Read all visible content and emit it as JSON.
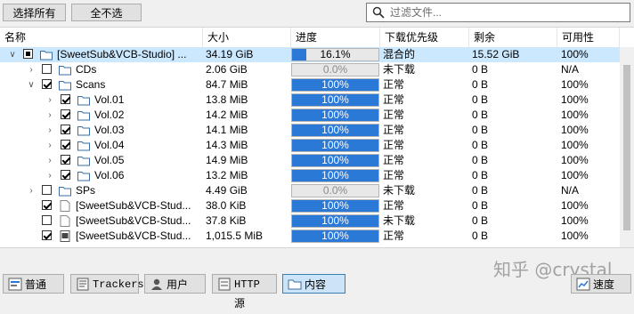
{
  "toolbar": {
    "select_all_label": "选择所有",
    "select_none_label": "全不选",
    "filter_placeholder": "过滤文件..."
  },
  "columns": [
    "名称",
    "大小",
    "进度",
    "下载优先级",
    "剩余",
    "可用性"
  ],
  "rows": [
    {
      "name": "[SweetSub&VCB-Studio] ...",
      "size": "34.19 GiB",
      "progress_text": "16.1%",
      "progress": 0.161,
      "priority": "混合的",
      "remaining": "15.52 GiB",
      "availability": "100%",
      "check": "partial",
      "type": "folder",
      "expander": "open",
      "level": 0
    },
    {
      "name": "CDs",
      "size": "2.06 GiB",
      "progress_text": "0.0%",
      "progress": 0.0,
      "priority": "未下载",
      "remaining": "0 B",
      "availability": "N/A",
      "check": "unchecked",
      "type": "folder",
      "expander": "closed",
      "level": 1
    },
    {
      "name": "Scans",
      "size": "84.7 MiB",
      "progress_text": "100%",
      "progress": 1.0,
      "priority": "正常",
      "remaining": "0 B",
      "availability": "100%",
      "check": "checked",
      "type": "folder",
      "expander": "open",
      "level": 1
    },
    {
      "name": "Vol.01",
      "size": "13.8 MiB",
      "progress_text": "100%",
      "progress": 1.0,
      "priority": "正常",
      "remaining": "0 B",
      "availability": "100%",
      "check": "checked",
      "type": "folder",
      "expander": "closed",
      "level": 2
    },
    {
      "name": "Vol.02",
      "size": "14.2 MiB",
      "progress_text": "100%",
      "progress": 1.0,
      "priority": "正常",
      "remaining": "0 B",
      "availability": "100%",
      "check": "checked",
      "type": "folder",
      "expander": "closed",
      "level": 2
    },
    {
      "name": "Vol.03",
      "size": "14.1 MiB",
      "progress_text": "100%",
      "progress": 1.0,
      "priority": "正常",
      "remaining": "0 B",
      "availability": "100%",
      "check": "checked",
      "type": "folder",
      "expander": "closed",
      "level": 2
    },
    {
      "name": "Vol.04",
      "size": "14.3 MiB",
      "progress_text": "100%",
      "progress": 1.0,
      "priority": "正常",
      "remaining": "0 B",
      "availability": "100%",
      "check": "checked",
      "type": "folder",
      "expander": "closed",
      "level": 2
    },
    {
      "name": "Vol.05",
      "size": "14.9 MiB",
      "progress_text": "100%",
      "progress": 1.0,
      "priority": "正常",
      "remaining": "0 B",
      "availability": "100%",
      "check": "checked",
      "type": "folder",
      "expander": "closed",
      "level": 2
    },
    {
      "name": "Vol.06",
      "size": "13.2 MiB",
      "progress_text": "100%",
      "progress": 1.0,
      "priority": "正常",
      "remaining": "0 B",
      "availability": "100%",
      "check": "checked",
      "type": "folder",
      "expander": "closed",
      "level": 2
    },
    {
      "name": "SPs",
      "size": "4.49 GiB",
      "progress_text": "0.0%",
      "progress": 0.0,
      "priority": "未下载",
      "remaining": "0 B",
      "availability": "N/A",
      "check": "unchecked",
      "type": "folder",
      "expander": "closed",
      "level": 1
    },
    {
      "name": "[SweetSub&VCB-Stud...",
      "size": "38.0 KiB",
      "progress_text": "100%",
      "progress": 1.0,
      "priority": "正常",
      "remaining": "0 B",
      "availability": "100%",
      "check": "checked",
      "type": "file",
      "expander": "none",
      "level": 1
    },
    {
      "name": "[SweetSub&VCB-Stud...",
      "size": "37.8 KiB",
      "progress_text": "100%",
      "progress": 1.0,
      "priority": "未下载",
      "remaining": "0 B",
      "availability": "100%",
      "check": "unchecked",
      "type": "file",
      "expander": "none",
      "level": 1
    },
    {
      "name": "[SweetSub&VCB-Stud...",
      "size": "1,015.5 MiB",
      "progress_text": "100%",
      "progress": 1.0,
      "priority": "正常",
      "remaining": "0 B",
      "availability": "100%",
      "check": "checked",
      "type": "video",
      "expander": "none",
      "level": 1
    }
  ],
  "tabs": [
    {
      "label": "普通",
      "icon": "info-icon",
      "mono": false
    },
    {
      "label": "Trackers",
      "icon": "trackers-icon",
      "mono": true
    },
    {
      "label": "用户",
      "icon": "users-icon",
      "mono": false
    },
    {
      "label": "HTTP 源",
      "icon": "http-source-icon",
      "mono": true
    },
    {
      "label": "内容",
      "icon": "folder-icon",
      "mono": false,
      "active": true
    }
  ],
  "speed_tab": {
    "label": "速度",
    "icon": "speed-chart-icon"
  },
  "watermark": "知乎 @crystal",
  "colors": {
    "progress_fill": "#2a79d7",
    "selection": "#cce8ff",
    "active_tab": "#cce4f7"
  }
}
